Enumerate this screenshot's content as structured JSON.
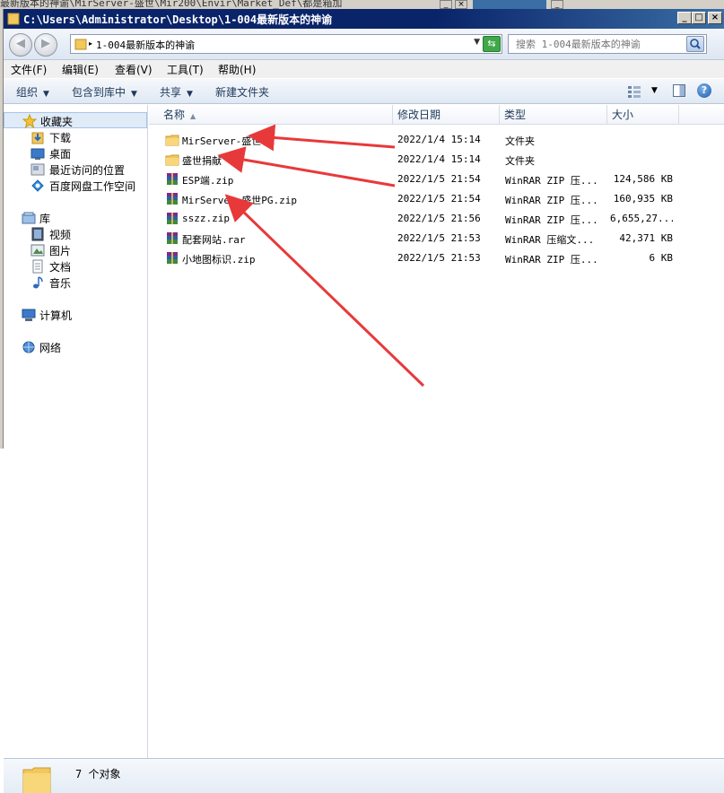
{
  "background_window": {
    "title_fragment": "最新版本的神谕\\MirServer-盛世\\Mir200\\Envir\\Market_Def\\都是箱加"
  },
  "window": {
    "title": "C:\\Users\\Administrator\\Desktop\\1-004最新版本的神谕",
    "minimize_label": "_",
    "maximize_label": "□",
    "close_label": "×"
  },
  "address": {
    "path_label": "1-004最新版本的神谕",
    "separator": "▸",
    "search_placeholder": "搜索 1-004最新版本的神谕"
  },
  "menu": {
    "items": [
      "文件(F)",
      "编辑(E)",
      "查看(V)",
      "工具(T)",
      "帮助(H)"
    ]
  },
  "toolbar": {
    "organize": "组织",
    "include_library": "包含到库中",
    "share": "共享",
    "new_folder": "新建文件夹"
  },
  "nav": {
    "favorites": "收藏夹",
    "downloads": "下载",
    "desktop": "桌面",
    "recent": "最近访问的位置",
    "baidu": "百度网盘工作空间",
    "libraries": "库",
    "videos": "视频",
    "pictures": "图片",
    "documents": "文档",
    "music": "音乐",
    "computer": "计算机",
    "network": "网络"
  },
  "columns": {
    "name": "名称",
    "date": "修改日期",
    "type": "类型",
    "size": "大小"
  },
  "files": [
    {
      "name": "MirServer-盛世",
      "date": "2022/1/4 15:14",
      "type": "文件夹",
      "size": "",
      "kind": "folder"
    },
    {
      "name": "盛世捐献",
      "date": "2022/1/4 15:14",
      "type": "文件夹",
      "size": "",
      "kind": "folder"
    },
    {
      "name": "ESP端.zip",
      "date": "2022/1/5 21:54",
      "type": "WinRAR ZIP 压...",
      "size": "124,586 KB",
      "kind": "archive"
    },
    {
      "name": "MirServer-盛世PG.zip",
      "date": "2022/1/5 21:54",
      "type": "WinRAR ZIP 压...",
      "size": "160,935 KB",
      "kind": "archive"
    },
    {
      "name": "sszz.zip",
      "date": "2022/1/5 21:56",
      "type": "WinRAR ZIP 压...",
      "size": "6,655,27...",
      "kind": "archive"
    },
    {
      "name": "配套网站.rar",
      "date": "2022/1/5 21:53",
      "type": "WinRAR 压缩文...",
      "size": "42,371 KB",
      "kind": "archive"
    },
    {
      "name": "小地图标识.zip",
      "date": "2022/1/5 21:53",
      "type": "WinRAR ZIP 压...",
      "size": "6 KB",
      "kind": "archive"
    }
  ],
  "status": {
    "count_text": "7 个对象"
  },
  "colors": {
    "title_bar": "#0a246a",
    "annotation_arrow": "#e8393a",
    "folder": "#f2c75c"
  }
}
